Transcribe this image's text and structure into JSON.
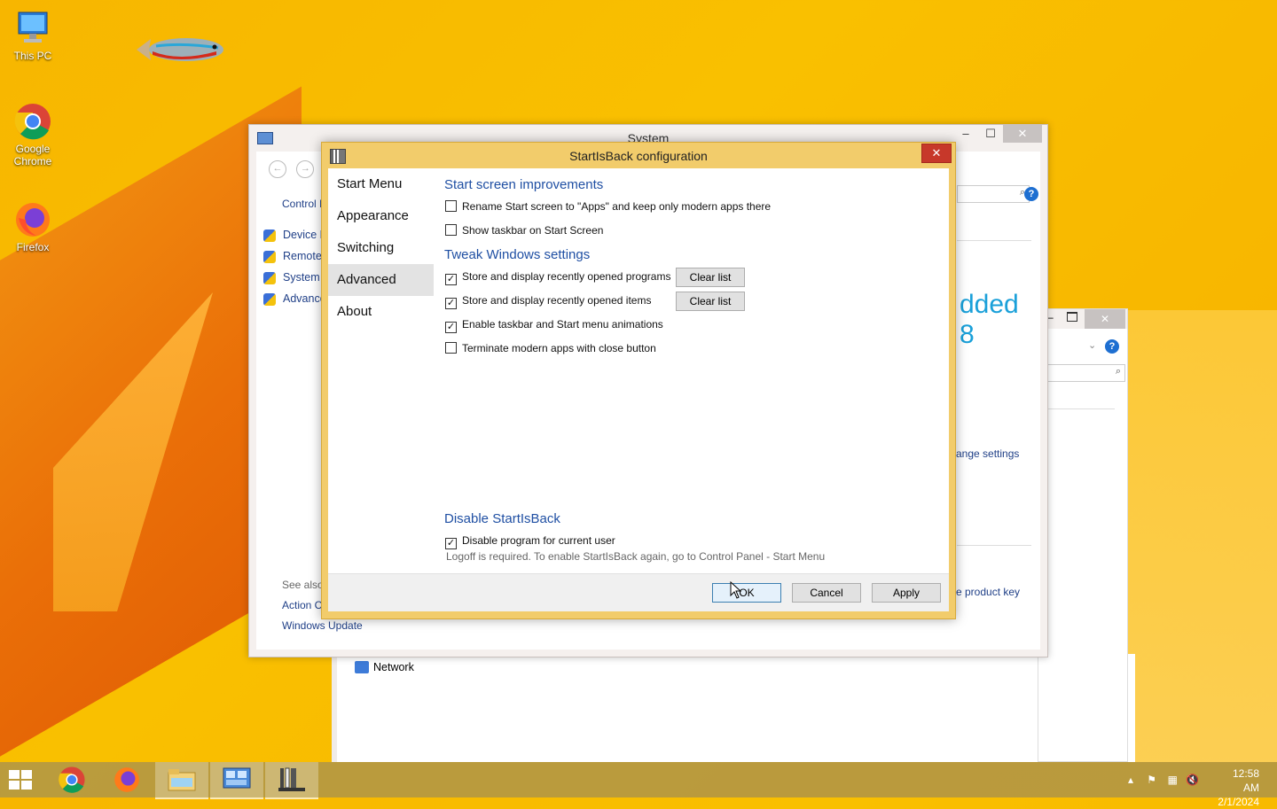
{
  "desktop": {
    "icons": [
      {
        "label": "This PC",
        "icon": "computer-icon"
      },
      {
        "label": "Google Chrome",
        "icon": "chrome-icon"
      },
      {
        "label": "Firefox",
        "icon": "firefox-icon"
      }
    ]
  },
  "system_window": {
    "title": "System",
    "left_links": {
      "control": "Control I",
      "device": "Device M",
      "remote": "Remote",
      "system": "System p",
      "advanced": "Advance"
    },
    "big_text": "dded 8",
    "change_settings": "ange settings",
    "product_key": "e product key",
    "see_also": "See also",
    "action_center": "Action C",
    "windows_update": "Windows Update"
  },
  "network_window": {
    "network_label": "Network"
  },
  "dialog": {
    "title": "StartIsBack configuration",
    "close_label": "✕",
    "sidebar": [
      {
        "label": "Start Menu"
      },
      {
        "label": "Appearance"
      },
      {
        "label": "Switching"
      },
      {
        "label": "Advanced"
      },
      {
        "label": "About"
      }
    ],
    "selected_tab": "Advanced",
    "sections": {
      "start_screen": "Start screen improvements",
      "tweak": "Tweak Windows settings",
      "disable": "Disable StartIsBack"
    },
    "options": {
      "rename": {
        "label": "Rename Start screen to \"Apps\" and keep only modern apps there",
        "checked": false
      },
      "show_taskbar": {
        "label": "Show taskbar on Start Screen",
        "checked": false
      },
      "recent_programs": {
        "label": "Store and display recently opened programs",
        "checked": true
      },
      "recent_items": {
        "label": "Store and display recently opened items",
        "checked": true
      },
      "animations": {
        "label": "Enable taskbar and Start menu animations",
        "checked": true
      },
      "terminate": {
        "label": "Terminate modern apps with close button",
        "checked": false
      },
      "disable_program": {
        "label": "Disable program for current user",
        "checked": true
      }
    },
    "clear_list_label": "Clear list",
    "logoff_note": "Logoff is required. To enable StartIsBack again, go to Control Panel - Start Menu",
    "buttons": {
      "ok": "OK",
      "cancel": "Cancel",
      "apply": "Apply"
    }
  },
  "taskbar": {
    "time": "12:58 AM",
    "date": "2/1/2024"
  },
  "colors": {
    "desktop_bg": "#f7b600",
    "dialog_frame": "#f2cc6b",
    "heading_blue": "#1f4fa3",
    "close_red": "#c7382a"
  }
}
